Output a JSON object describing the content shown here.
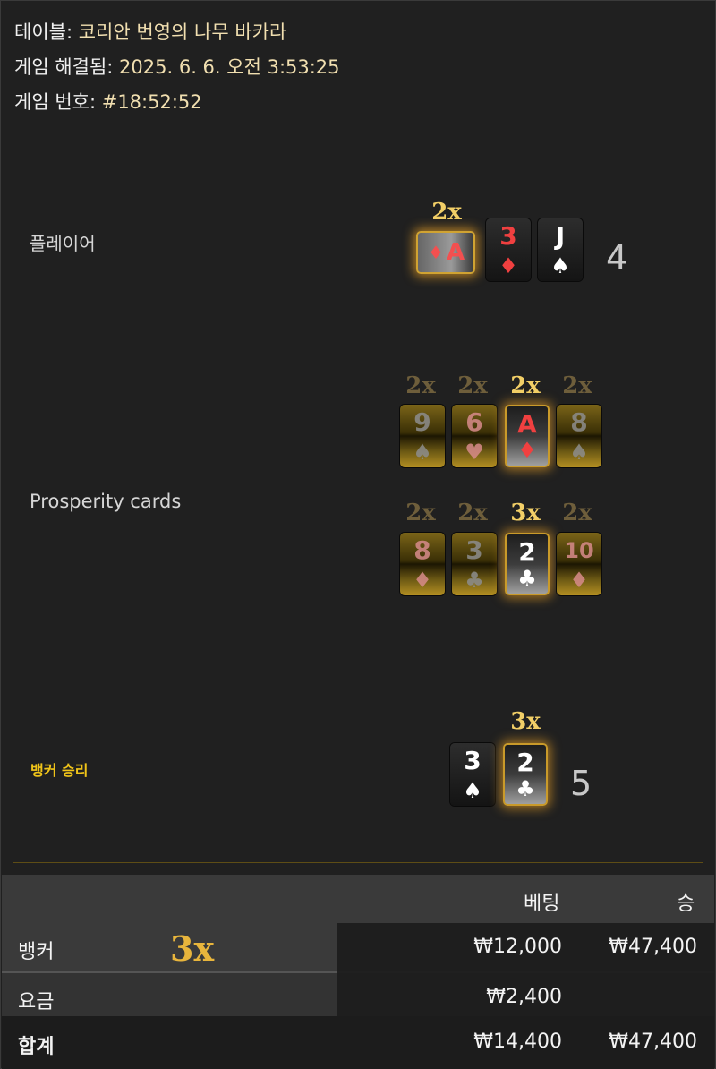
{
  "header": {
    "table_label": "테이블:",
    "table_value": "코리안 번영의 나무 바카라",
    "resolved_label": "게임 해결됨:",
    "resolved_value": "2025. 6. 6. 오전 3:53:25",
    "game_no_label": "게임 번호:",
    "game_no_value": "#18:52:52"
  },
  "player": {
    "label": "플레이어",
    "score": "4",
    "cards": [
      {
        "rank": "A",
        "suit": "♦",
        "color": "red",
        "multiplier": "2x",
        "style": "rotated-selected"
      },
      {
        "rank": "3",
        "suit": "♦",
        "color": "red",
        "multiplier": "",
        "style": "normal"
      },
      {
        "rank": "J",
        "suit": "♠",
        "color": "white",
        "multiplier": "",
        "style": "normal"
      }
    ]
  },
  "prosperity": {
    "label": "Prosperity cards",
    "row1": [
      {
        "rank": "9",
        "suit": "♠",
        "multiplier": "2x",
        "style": "gold-gray"
      },
      {
        "rank": "6",
        "suit": "♥",
        "multiplier": "2x",
        "style": "gold-pink"
      },
      {
        "rank": "A",
        "suit": "♦",
        "multiplier": "2x",
        "style": "selected-red"
      },
      {
        "rank": "8",
        "suit": "♠",
        "multiplier": "2x",
        "style": "gold-gray"
      }
    ],
    "row2": [
      {
        "rank": "8",
        "suit": "♦",
        "multiplier": "2x",
        "style": "gold-pink"
      },
      {
        "rank": "3",
        "suit": "♣",
        "multiplier": "2x",
        "style": "gold-gray"
      },
      {
        "rank": "2",
        "suit": "♣",
        "multiplier": "3x",
        "style": "selected-white"
      },
      {
        "rank": "10",
        "suit": "♦",
        "multiplier": "2x",
        "style": "gold-pink"
      }
    ]
  },
  "banker": {
    "result_text": "뱅커 승리",
    "score": "5",
    "cards": [
      {
        "rank": "3",
        "suit": "♠",
        "multiplier": "",
        "style": "normal"
      },
      {
        "rank": "2",
        "suit": "♣",
        "multiplier": "3x",
        "style": "selected-white"
      }
    ]
  },
  "bets_table": {
    "col_bet": "베팅",
    "col_win": "승",
    "rows": [
      {
        "name": "뱅커",
        "multiplier": "3x",
        "bet": "₩12,000",
        "win": "₩47,400"
      },
      {
        "name": "요금",
        "multiplier": "",
        "bet": "₩2,400",
        "win": ""
      },
      {
        "name": "합계",
        "multiplier": "",
        "bet": "₩14,400",
        "win": "₩47,400"
      }
    ]
  },
  "colors": {
    "background": "#202020",
    "gold": "#f2cf67",
    "win_text": "#f0c419",
    "red_suit": "#f04040"
  }
}
